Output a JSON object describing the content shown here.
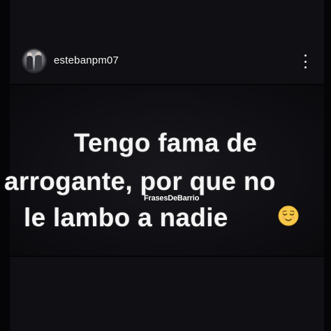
{
  "post": {
    "username": "estebanpm07",
    "caption_lines": [
      "Tengo fama de",
      "arrogante, por que no",
      "le lambo a nadie"
    ],
    "watermark": "FrasesDeBarrio",
    "emoji": "relieved-face-icon"
  },
  "icons": {
    "more": "more-options-icon",
    "avatar": "avatar"
  },
  "colors": {
    "background": "#0d0d10",
    "text": "#f4f4f4",
    "emoji_face": "#f7c948"
  }
}
